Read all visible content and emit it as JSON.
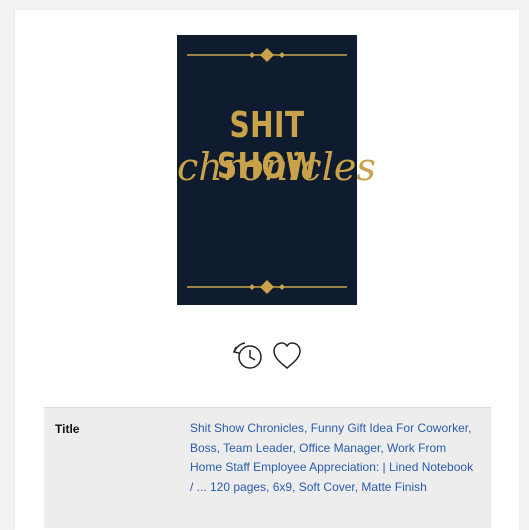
{
  "book": {
    "cover": {
      "line1": "SHIT SHOW",
      "line2": "chronicles"
    },
    "actions": {
      "history_icon": "clock-history-icon",
      "favorite_icon": "heart-icon"
    },
    "details": {
      "title_label": "Title",
      "title_value": "Shit Show Chronicles, Funny Gift Idea For Coworker, Boss, Team Leader, Office Manager, Work From Home Staff Employee Appreciation: | Lined Notebook / ... 120 pages, 6x9, Soft Cover, Matte Finish"
    }
  },
  "colors": {
    "cover_bg": "#0f1b2e",
    "gold": "#c9a24a",
    "link": "#2a5caa"
  }
}
